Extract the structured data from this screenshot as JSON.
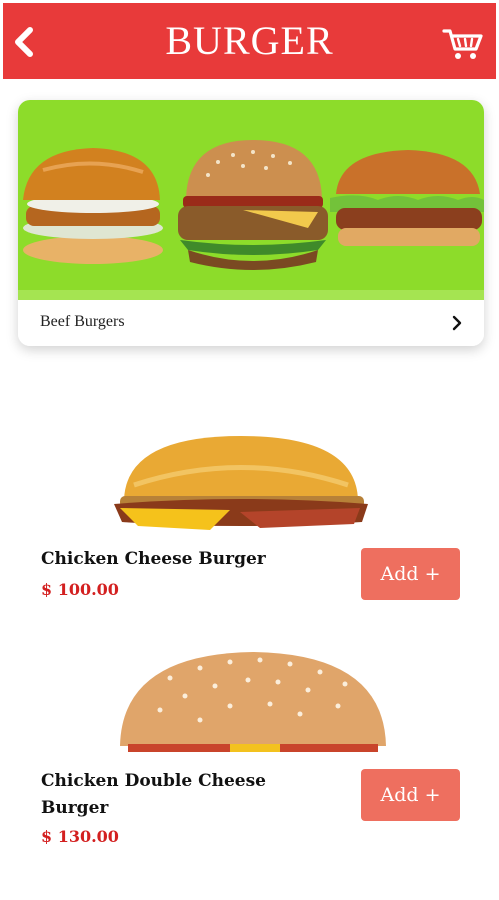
{
  "header": {
    "title": "BURGER",
    "background": "#e83a3a",
    "back_icon": "chevron-left-icon",
    "cart_icon": "shopping-cart-icon"
  },
  "banner": {
    "label": "Beef Burgers",
    "background": "#8ddc2a",
    "chevron_icon": "chevron-right-icon"
  },
  "items": [
    {
      "name": "Chicken Cheese Burger",
      "price": "$ 100.00",
      "button_label": "Add +"
    },
    {
      "name": "Chicken Double Cheese Burger",
      "price": "$ 130.00",
      "button_label": "Add +"
    }
  ],
  "colors": {
    "accent": "#e83a3a",
    "price": "#d32020",
    "add_button": "#ee6f5f"
  }
}
